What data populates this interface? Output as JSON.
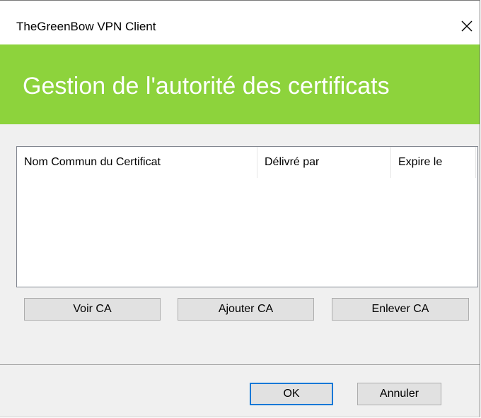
{
  "window": {
    "title": "TheGreenBow VPN Client",
    "close_icon": "close-icon"
  },
  "banner": {
    "title": "Gestion de l'autorité des certificats",
    "color": "#8dd33c"
  },
  "certificate_list": {
    "columns": [
      "Nom Commun du Certificat",
      "Délivré par",
      "Expire le"
    ],
    "rows": []
  },
  "actions": {
    "view_label": "Voir CA",
    "add_label": "Ajouter CA",
    "remove_label": "Enlever CA"
  },
  "footer": {
    "ok_label": "OK",
    "cancel_label": "Annuler"
  },
  "colors": {
    "accent": "#0078d7",
    "banner": "#8dd33c"
  }
}
